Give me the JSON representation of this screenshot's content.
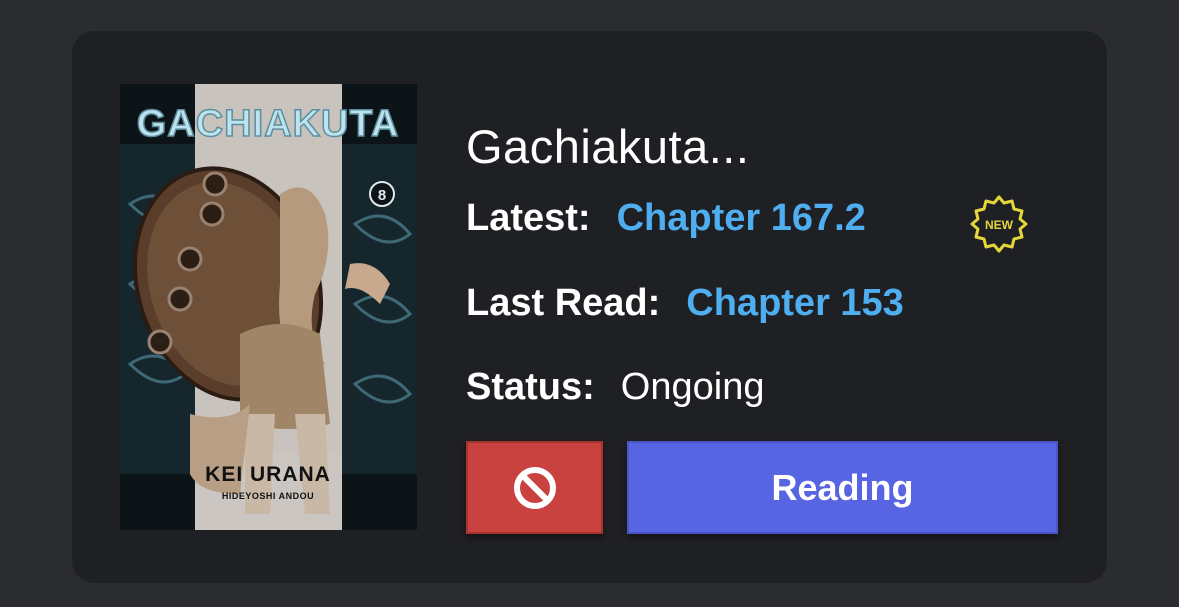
{
  "manga": {
    "title": "Gachiakuta...",
    "cover": {
      "logo_text": "GACHIAKUTA",
      "volume": "8",
      "author": "KEI URANA",
      "credit": "HIDEYOSHI ANDOU"
    },
    "latest": {
      "label": "Latest:",
      "chapter": "Chapter 167.2",
      "badge": "NEW"
    },
    "last_read": {
      "label": "Last Read:",
      "chapter": "Chapter 153"
    },
    "status": {
      "label": "Status:",
      "value": "Ongoing"
    }
  },
  "actions": {
    "block_icon": "block-icon",
    "reading_label": "Reading"
  },
  "colors": {
    "background": "#2b2c30",
    "card": "#1f2023",
    "link": "#4eaef0",
    "badge": "#e5d63a",
    "block_button": "#c9423f",
    "reading_button": "#5865e3"
  }
}
